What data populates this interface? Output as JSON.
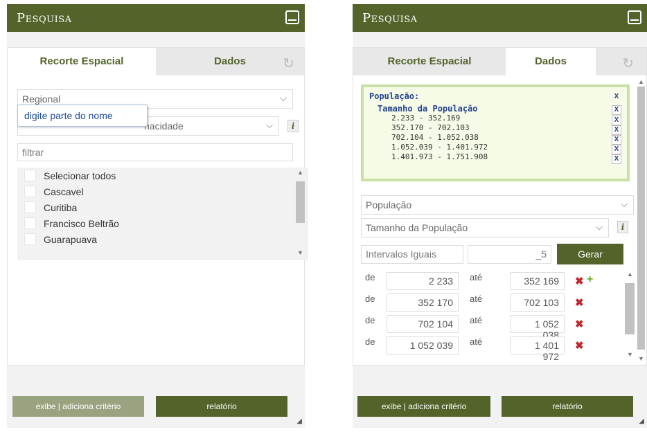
{
  "left": {
    "title": "Pesquisa",
    "tabs": [
      "Recorte Espacial",
      "Dados"
    ],
    "region_select": "Regional",
    "tooltip": "digite parte do nome",
    "second_select_text": "nacidade",
    "filter_placeholder": "filtrar",
    "list_items": [
      "Selecionar todos",
      "Cascavel",
      "Curitiba",
      "Francisco Beltrão",
      "Guarapuava"
    ],
    "buttons": {
      "add_criteria": "exibe | adiciona critério",
      "report": "relatório"
    }
  },
  "right": {
    "title": "Pesquisa",
    "tabs": [
      "Recorte Espacial",
      "Dados"
    ],
    "filter": {
      "title": "População:",
      "x": "X",
      "subtitle": "Tamanho da População",
      "ranges": [
        "2.233 - 352.169",
        "352.170 - 702.103",
        "702.104 - 1.052.038",
        "1.052.039 - 1.401.972",
        "1.401.973 - 1.751.908"
      ]
    },
    "select1": "População",
    "select2": "Tamanho da População",
    "method": "Intervalos Iguais",
    "classes": "_5",
    "gerar": "Gerar",
    "de_label": "de",
    "ate_label": "até",
    "intervals": [
      {
        "from": "2 233",
        "to": "352 169"
      },
      {
        "from": "352 170",
        "to": "702 103"
      },
      {
        "from": "702 104",
        "to": "1 052 038"
      },
      {
        "from": "1 052 039",
        "to": "1 401 972"
      }
    ],
    "buttons": {
      "add_criteria": "exibe | adiciona critério",
      "report": "relatório"
    }
  },
  "colors": {
    "brand": "#53632a",
    "filter_bg": "#f6fbe7",
    "filter_border": "#cbe0a5",
    "link_blue": "#23428c",
    "remove_red": "#c0272d",
    "add_green": "#6ab023"
  }
}
